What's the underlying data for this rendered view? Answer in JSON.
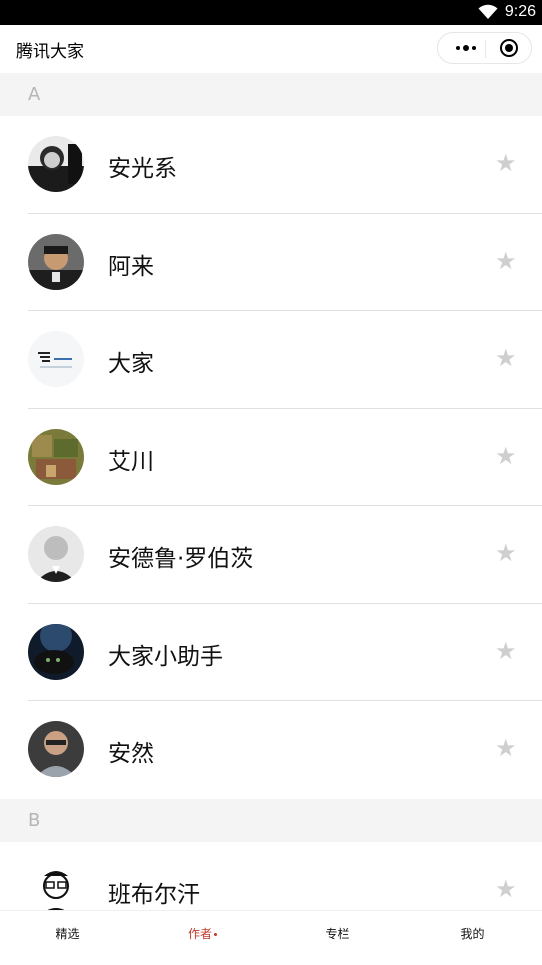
{
  "status_bar": {
    "time": "9:26"
  },
  "nav": {
    "title": "腾讯大家"
  },
  "sections": [
    {
      "letter": "A",
      "authors": [
        {
          "name": "安光系",
          "favorited": false
        },
        {
          "name": "阿来",
          "favorited": false
        },
        {
          "name": "大家",
          "favorited": false
        },
        {
          "name": "艾川",
          "favorited": false
        },
        {
          "name": "安德鲁·罗伯茨",
          "favorited": false
        },
        {
          "name": "大家小助手",
          "favorited": false
        },
        {
          "name": "安然",
          "favorited": false
        }
      ]
    },
    {
      "letter": "B",
      "authors": [
        {
          "name": "班布尔汗",
          "favorited": false
        }
      ]
    }
  ],
  "tabs": [
    {
      "label": "精选",
      "active": false
    },
    {
      "label": "作者",
      "active": true
    },
    {
      "label": "专栏",
      "active": false
    },
    {
      "label": "我的",
      "active": false
    }
  ],
  "colors": {
    "active_tab": "#c0392b",
    "star": "#cfcfcf",
    "section_bg": "#f4f4f4"
  }
}
